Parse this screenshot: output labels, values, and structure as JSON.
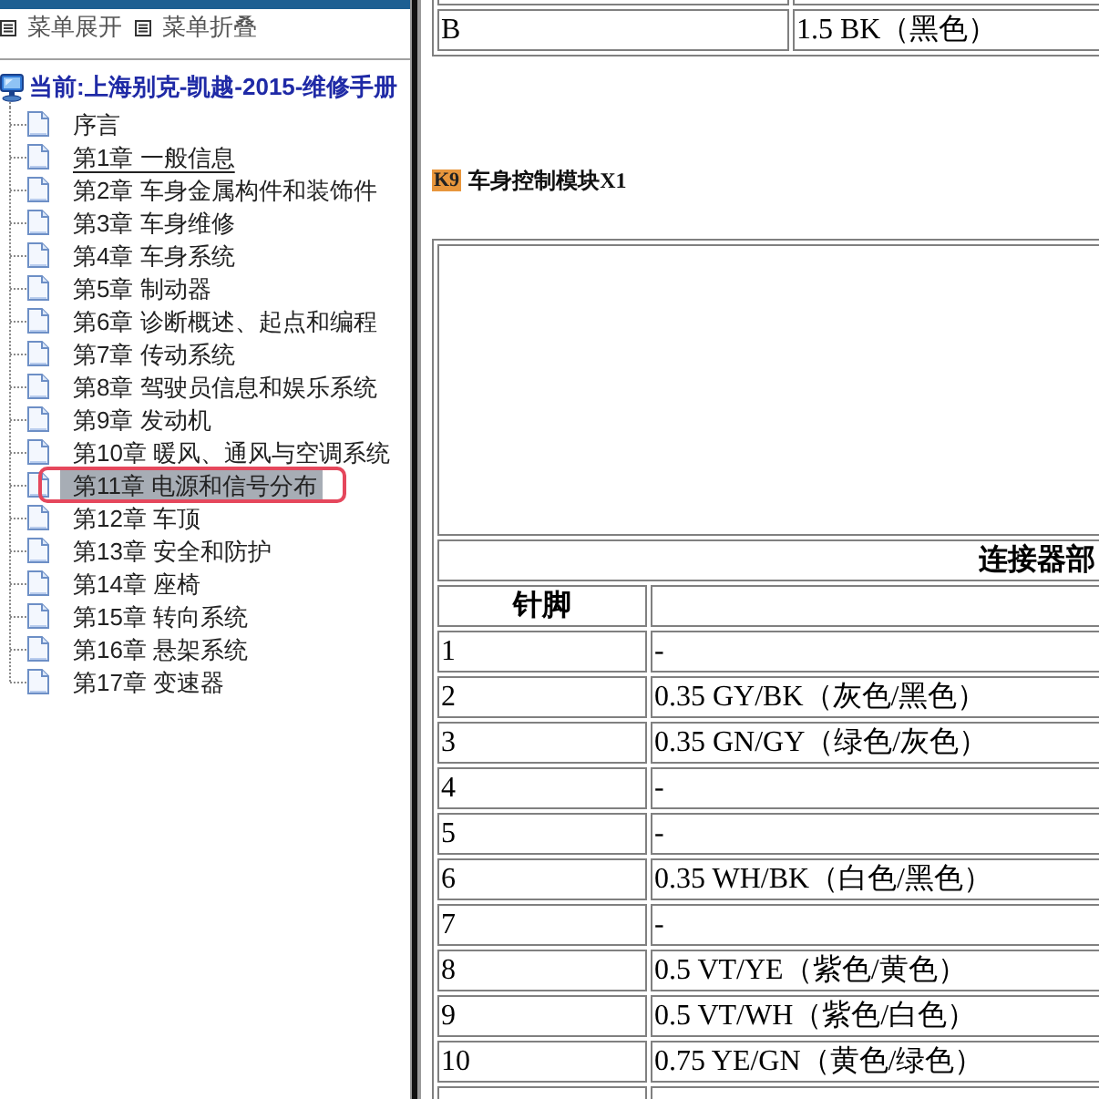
{
  "sidebar": {
    "toolbar": [
      {
        "label": "菜单展开"
      },
      {
        "label": "菜单折叠"
      }
    ],
    "tree": {
      "label": "当前:上海别克-凯越-2015-维修手册",
      "children": [
        {
          "label": "序言",
          "selected": false,
          "hovered": false,
          "framed": false
        },
        {
          "label": "第1章 一般信息",
          "selected": false,
          "hovered": true,
          "framed": false
        },
        {
          "label": "第2章 车身金属构件和装饰件",
          "selected": false,
          "hovered": false,
          "framed": false
        },
        {
          "label": "第3章 车身维修",
          "selected": false,
          "hovered": false,
          "framed": false
        },
        {
          "label": "第4章 车身系统",
          "selected": false,
          "hovered": false,
          "framed": false
        },
        {
          "label": "第5章 制动器",
          "selected": false,
          "hovered": false,
          "framed": false
        },
        {
          "label": "第6章 诊断概述、起点和编程",
          "selected": false,
          "hovered": false,
          "framed": false
        },
        {
          "label": "第7章 传动系统",
          "selected": false,
          "hovered": false,
          "framed": false
        },
        {
          "label": "第8章 驾驶员信息和娱乐系统",
          "selected": false,
          "hovered": false,
          "framed": false
        },
        {
          "label": "第9章 发动机",
          "selected": false,
          "hovered": false,
          "framed": false
        },
        {
          "label": "第10章 暖风、通风与空调系统",
          "selected": false,
          "hovered": false,
          "framed": false
        },
        {
          "label": "第11章 电源和信号分布",
          "selected": true,
          "hovered": false,
          "framed": true
        },
        {
          "label": "第12章 车顶",
          "selected": false,
          "hovered": false,
          "framed": false
        },
        {
          "label": "第13章 安全和防护",
          "selected": false,
          "hovered": false,
          "framed": false
        },
        {
          "label": "第14章 座椅",
          "selected": false,
          "hovered": false,
          "framed": false
        },
        {
          "label": "第15章 转向系统",
          "selected": false,
          "hovered": false,
          "framed": false
        },
        {
          "label": "第16章 悬架系统",
          "selected": false,
          "hovered": false,
          "framed": false
        },
        {
          "label": "第17章 变速器",
          "selected": false,
          "hovered": false,
          "framed": false
        }
      ]
    }
  },
  "content": {
    "wire_table": {
      "rows": [
        {
          "pin": "B",
          "wire": "1.5 BK（黑色）"
        }
      ]
    },
    "section": {
      "code": "K9",
      "title": "车身控制模块X1"
    },
    "connector_table": {
      "caption": "连接器部",
      "columns": [
        "针脚"
      ],
      "rows": [
        {
          "pin": "1",
          "wire": "-"
        },
        {
          "pin": "2",
          "wire": "0.35 GY/BK（灰色/黑色）"
        },
        {
          "pin": "3",
          "wire": "0.35 GN/GY（绿色/灰色）"
        },
        {
          "pin": "4",
          "wire": "-"
        },
        {
          "pin": "5",
          "wire": "-"
        },
        {
          "pin": "6",
          "wire": "0.35 WH/BK（白色/黑色）"
        },
        {
          "pin": "7",
          "wire": "-"
        },
        {
          "pin": "8",
          "wire": "0.5 VT/YE（紫色/黄色）"
        },
        {
          "pin": "9",
          "wire": "0.5 VT/WH（紫色/白色）"
        },
        {
          "pin": "10",
          "wire": "0.75 YE/GN（黄色/绿色）"
        }
      ]
    }
  }
}
